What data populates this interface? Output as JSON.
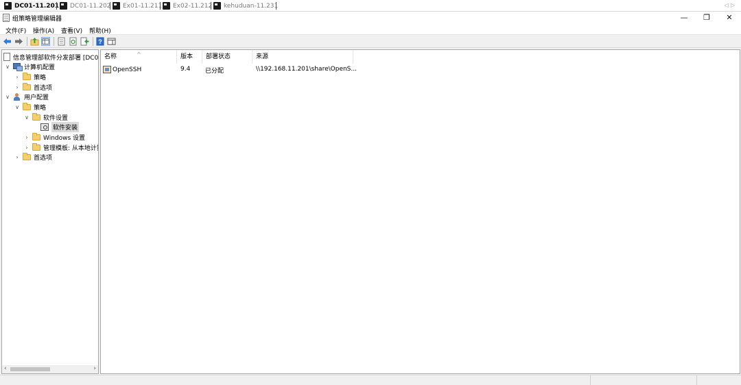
{
  "rdp_tabs": [
    {
      "label": "DC01-11.201",
      "active": true
    },
    {
      "label": "DC01-11.202",
      "active": false
    },
    {
      "label": "Ex01-11.211",
      "active": false
    },
    {
      "label": "Ex02-11.212",
      "active": false
    },
    {
      "label": "kehuduan-11.231",
      "active": false
    }
  ],
  "window": {
    "title": "组策略管理编辑器",
    "minimize": "—",
    "restore": "❐",
    "close": "✕"
  },
  "menu": [
    "文件(F)",
    "操作(A)",
    "查看(V)",
    "帮助(H)"
  ],
  "tree": {
    "root": "信息管理部软件分发部署 [DC0",
    "computer_config": "计算机配置",
    "cc_policies": "策略",
    "cc_preferences": "首选项",
    "user_config": "用户配置",
    "uc_policies": "策略",
    "software_settings": "软件设置",
    "software_install": "软件安装",
    "windows_settings": "Windows 设置",
    "admin_templates": "管理模板: 从本地计算",
    "uc_preferences": "首选项"
  },
  "list": {
    "columns": [
      "名称",
      "版本",
      "部署状态",
      "来源"
    ],
    "rows": [
      {
        "name": "OpenSSH",
        "version": "9.4",
        "status": "已分配",
        "source": "\\\\192.168.11.201\\share\\OpenS..."
      }
    ]
  },
  "colors": {
    "accent": "#2f7bd6",
    "folder": "#f5cf6b",
    "help": "#2f6fd0"
  }
}
